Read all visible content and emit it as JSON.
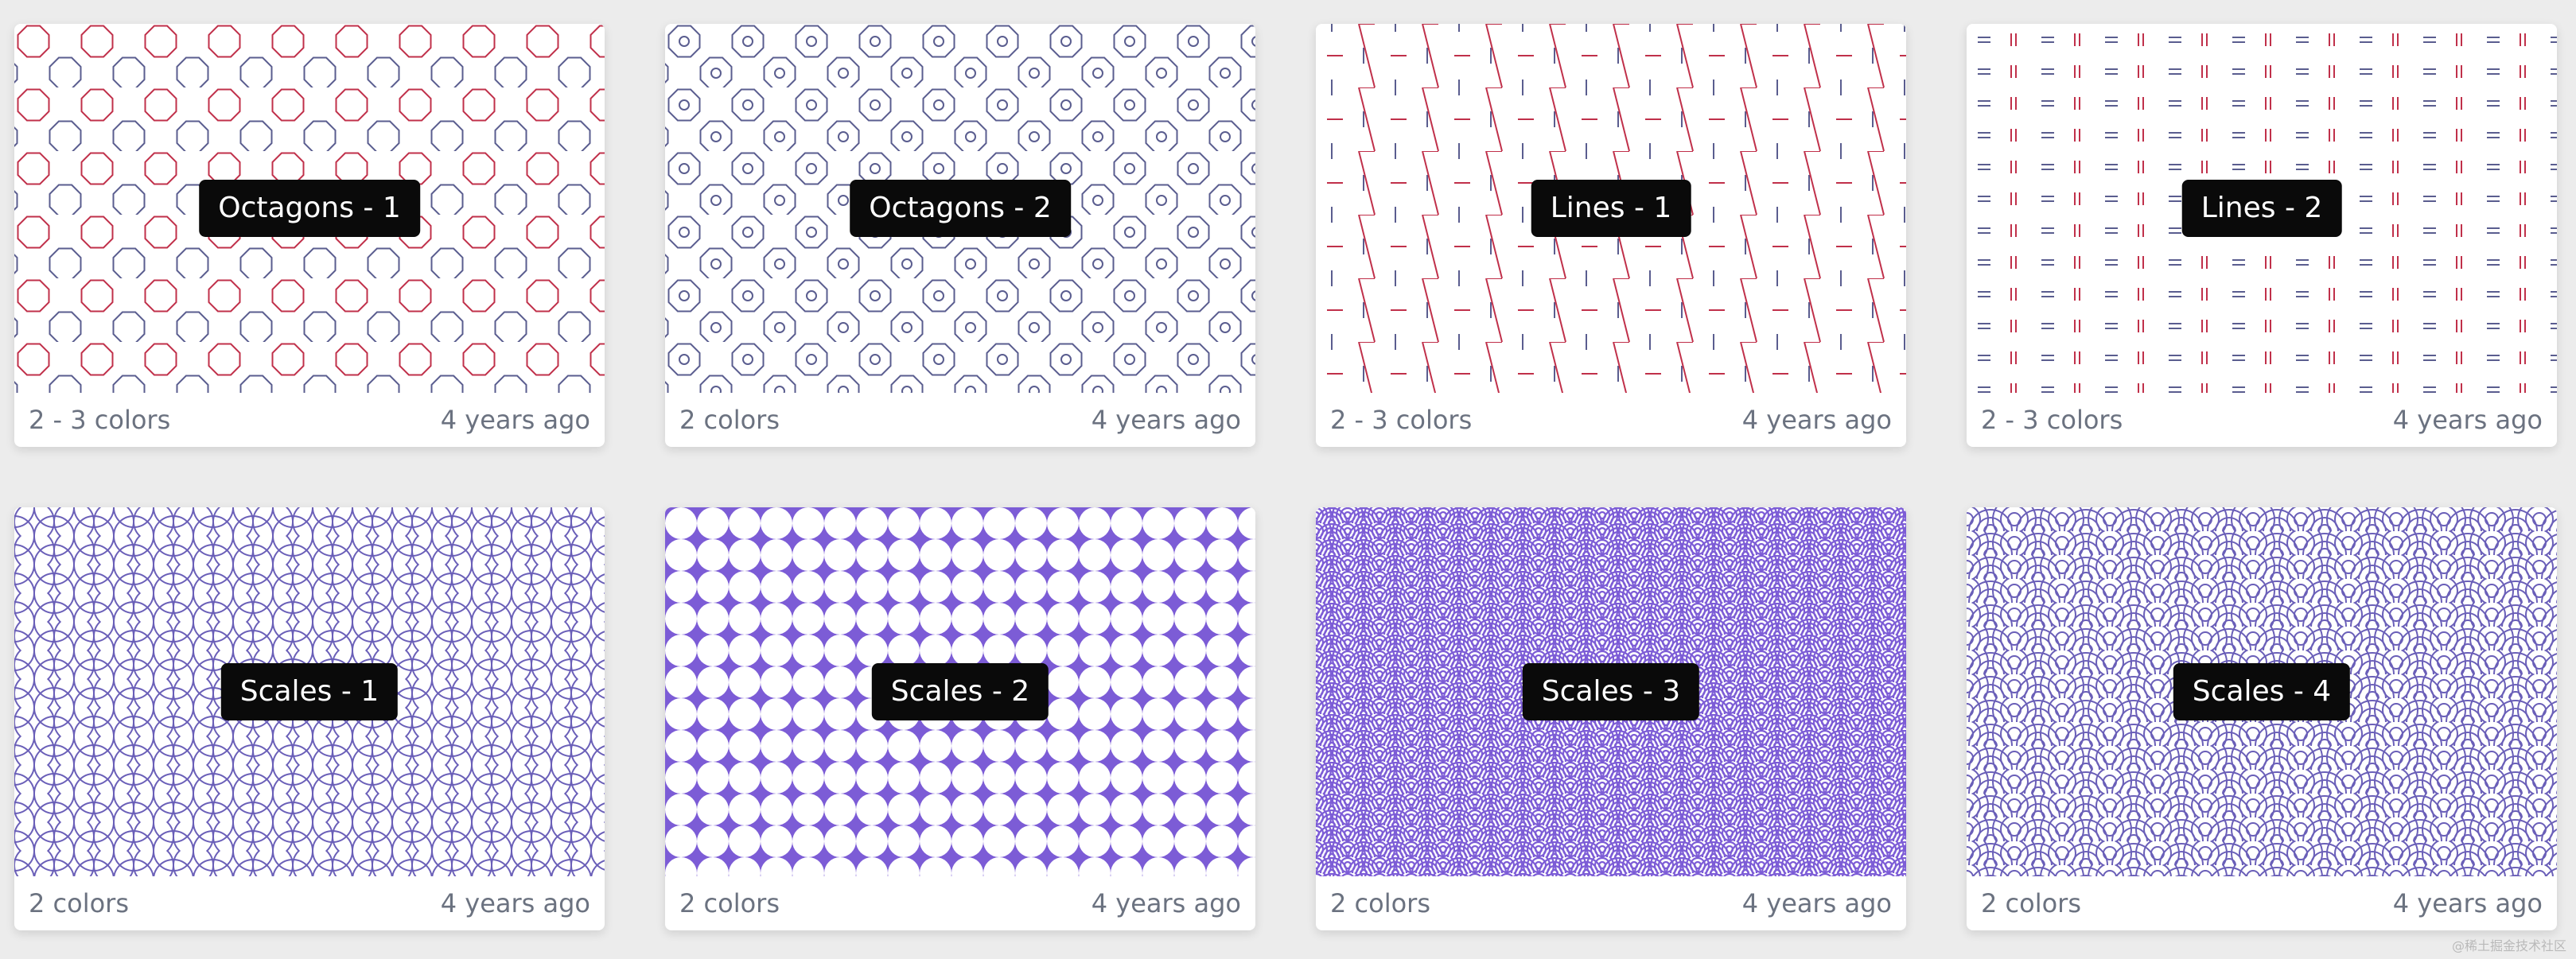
{
  "cards": [
    {
      "title": "Octagons - 1",
      "colors": "2 - 3 colors",
      "updated": "4 years ago",
      "pattern": "octagons-1"
    },
    {
      "title": "Octagons - 2",
      "colors": "2 colors",
      "updated": "4 years ago",
      "pattern": "octagons-2"
    },
    {
      "title": "Lines - 1",
      "colors": "2 - 3 colors",
      "updated": "4 years ago",
      "pattern": "lines-1"
    },
    {
      "title": "Lines - 2",
      "colors": "2 - 3 colors",
      "updated": "4 years ago",
      "pattern": "lines-2"
    },
    {
      "title": "Scales - 1",
      "colors": "2 colors",
      "updated": "4 years ago",
      "pattern": "scales-1"
    },
    {
      "title": "Scales - 2",
      "colors": "2 colors",
      "updated": "4 years ago",
      "pattern": "scales-2"
    },
    {
      "title": "Scales - 3",
      "colors": "2 colors",
      "updated": "4 years ago",
      "pattern": "scales-3"
    },
    {
      "title": "Scales - 4",
      "colors": "2 colors",
      "updated": "4 years ago",
      "pattern": "scales-4"
    }
  ],
  "watermark": "@稀土掘金技术社区",
  "palette": {
    "background": "#ececec",
    "purple": "#7c5cd6",
    "red": "#c0304a",
    "blue_gray": "#5a5d8f"
  }
}
